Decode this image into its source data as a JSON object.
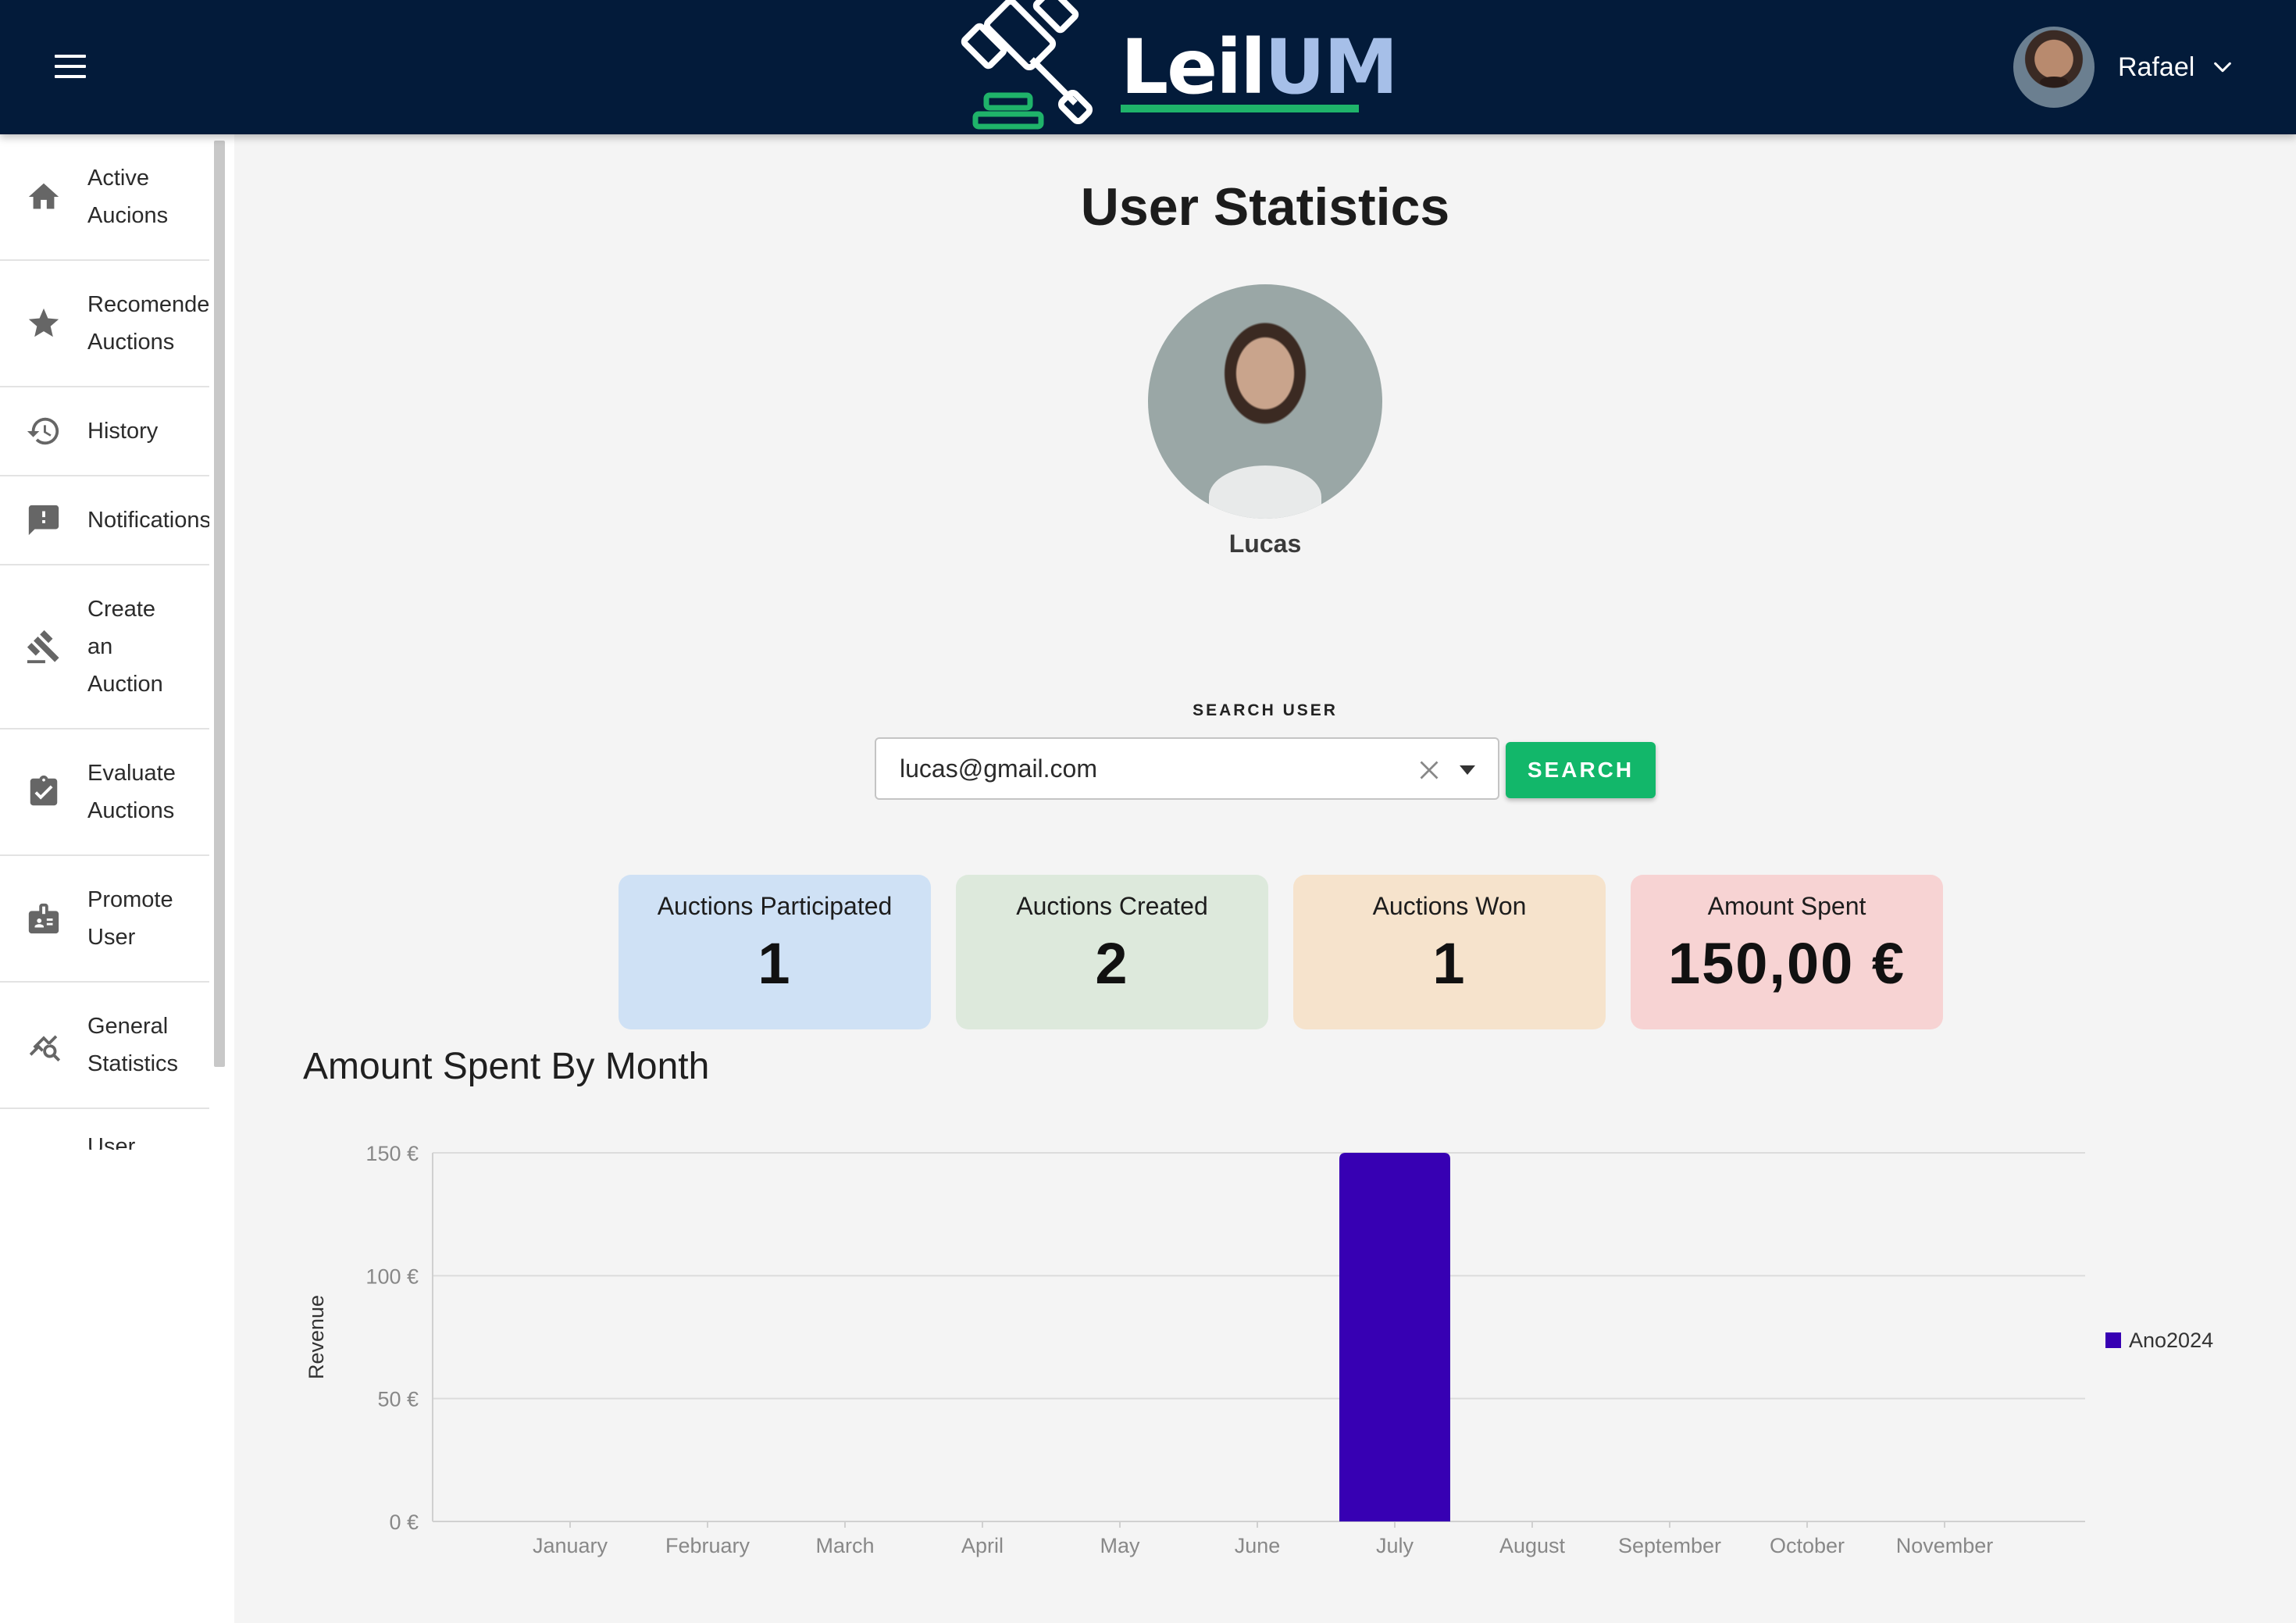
{
  "header": {
    "logo_text_a": "Leil",
    "logo_text_b": "UM",
    "user_name": "Rafael"
  },
  "sidebar": {
    "items": [
      {
        "label": "Active\nAucions",
        "icon": "home-icon"
      },
      {
        "label": "Recomended\nAuctions",
        "icon": "star-icon"
      },
      {
        "label": "History",
        "icon": "history-icon"
      },
      {
        "label": "Notifications",
        "icon": "feedback-icon"
      },
      {
        "label": "Create\nan\nAuction",
        "icon": "gavel-icon"
      },
      {
        "label": "Evaluate\nAuctions",
        "icon": "assignment-check-icon"
      },
      {
        "label": "Promote\nUser",
        "icon": "badge-icon"
      },
      {
        "label": "General\nStatistics",
        "icon": "query-stats-icon"
      },
      {
        "label": "User",
        "icon": "person-icon"
      }
    ]
  },
  "main": {
    "title": "User Statistics",
    "profile_name": "Lucas",
    "search": {
      "label": "SEARCH USER",
      "value": "lucas@gmail.com",
      "button_label": "SEARCH"
    },
    "stats": [
      {
        "title": "Auctions Participated",
        "value": "1",
        "color": "#cfe1f5"
      },
      {
        "title": "Auctions Created",
        "value": "2",
        "color": "#dde9dc"
      },
      {
        "title": "Auctions Won",
        "value": "1",
        "color": "#f6e3cc"
      },
      {
        "title": "Amount Spent",
        "value": "150,00 €",
        "color": "#f7d3d3"
      }
    ],
    "chart_title": "Amount Spent By Month"
  },
  "chart_data": {
    "type": "bar",
    "title": "Amount Spent By Month",
    "xlabel": "",
    "ylabel": "Revenue",
    "categories": [
      "January",
      "February",
      "March",
      "April",
      "May",
      "June",
      "July",
      "August",
      "September",
      "October",
      "November"
    ],
    "series": [
      {
        "name": "Ano2024",
        "color": "#3700b3",
        "values": [
          0,
          0,
          0,
          0,
          0,
          0,
          150,
          0,
          0,
          0,
          0
        ]
      }
    ],
    "ylim": [
      0,
      150
    ],
    "yticks": [
      0,
      50,
      100,
      150
    ],
    "ytick_labels": [
      "0 €",
      "50 €",
      "100 €",
      "150 €"
    ],
    "grid": true,
    "legend": "right"
  }
}
